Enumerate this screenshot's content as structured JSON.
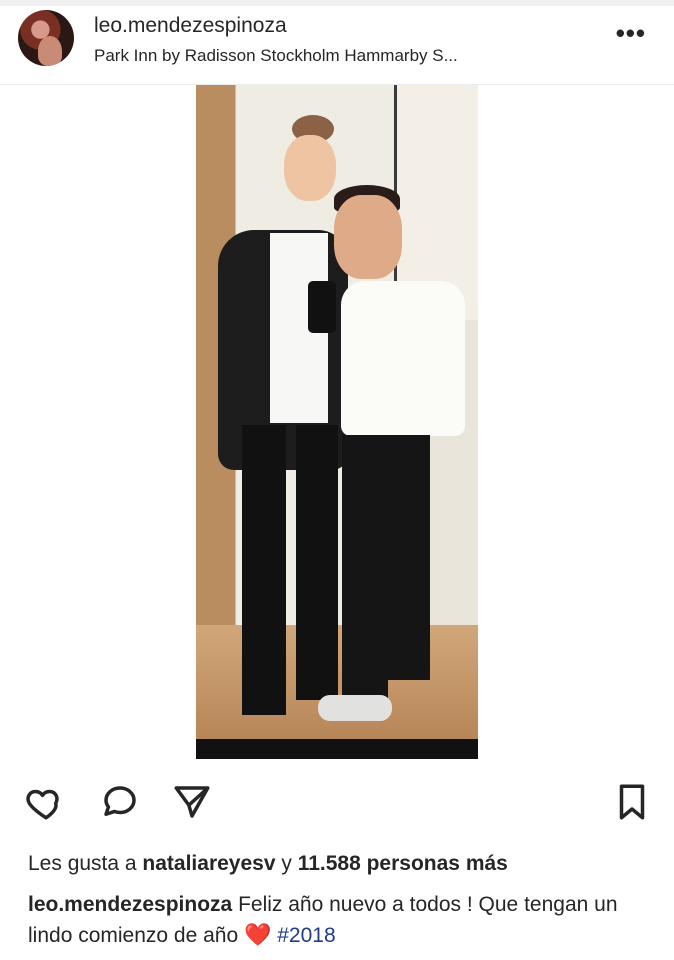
{
  "post": {
    "username": "leo.mendezespinoza",
    "location": "Park Inn by Radisson Stockholm Hammarby S...",
    "more_label": "•••",
    "likes_prefix": "Les gusta a ",
    "liked_by": "nataliareyesv",
    "likes_connector": " y ",
    "likes_count": "11.588 personas más",
    "caption_user": "leo.mendezespinoza",
    "caption_text_1": "Feliz año nuevo a todos ! Que tengan un lindo comienzo de año ",
    "caption_emoji": "❤️",
    "caption_hashtag": "#2018"
  },
  "colors": {
    "text": "#262626",
    "hashtag": "#1f3c88",
    "background": "#ffffff",
    "divider": "#ececec"
  },
  "icons": {
    "like": "heart-icon",
    "comment": "comment-icon",
    "share": "paper-plane-icon",
    "save": "bookmark-icon"
  }
}
